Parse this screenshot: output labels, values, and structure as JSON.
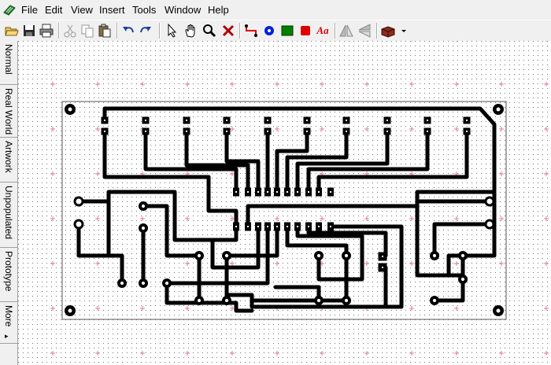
{
  "menubar": {
    "app_icon": "pcb-board-icon",
    "items": [
      "File",
      "Edit",
      "View",
      "Insert",
      "Tools",
      "Window",
      "Help"
    ]
  },
  "toolbar": {
    "buttons": [
      "open-folder-icon",
      "save-icon",
      "print-icon",
      "cut-icon",
      "copy-icon",
      "paste-icon",
      "undo-icon",
      "redo-icon",
      "select-arrow-icon",
      "pan-hand-icon",
      "zoom-icon",
      "delete-icon",
      "trace-icon",
      "pad-icon",
      "rect-icon",
      "filled-shape-icon",
      "text-icon",
      "flip-horizontal-icon",
      "flip-vertical-icon",
      "component-box-icon"
    ],
    "text_tool_label": "Aa"
  },
  "sidebar": {
    "tabs": [
      "Normal",
      "Real World",
      "Artwork",
      "Unpopulated",
      "Prototype",
      "More"
    ],
    "more_arrow": "▸"
  },
  "colors": {
    "trace": "#000000",
    "grid_dot": "#707070",
    "grid_cross": "#e07a9a",
    "board_outline": "#555555",
    "pad_dot": "#ffffff",
    "accent_red": "#e00000",
    "accent_blue": "#0000e0",
    "accent_green": "#008000"
  }
}
